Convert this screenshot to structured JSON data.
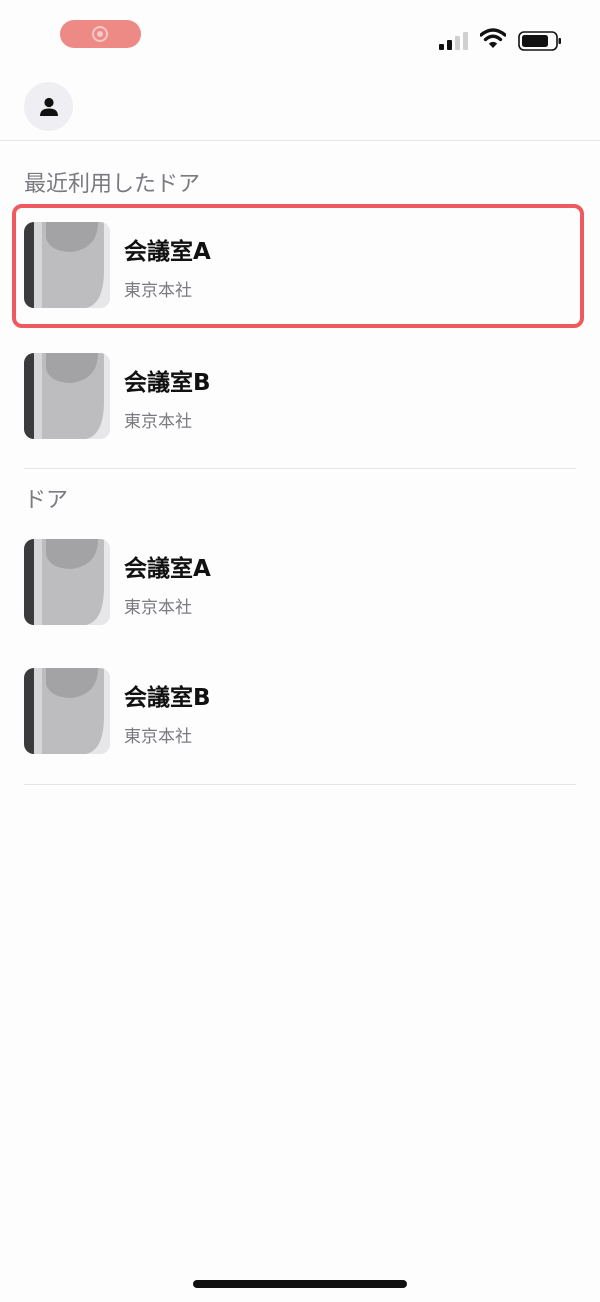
{
  "status_bar": {
    "recording_icon": "screen-recording-icon",
    "signal_icon": "cellular-signal-icon",
    "wifi_icon": "wifi-icon",
    "battery_icon": "battery-icon"
  },
  "header": {
    "profile_icon": "person-icon"
  },
  "recent_section": {
    "title": "最近利用したドア",
    "doors": [
      {
        "name": "会議室A",
        "location": "東京本社",
        "icon": "door-lock-thumbnail"
      },
      {
        "name": "会議室B",
        "location": "東京本社",
        "icon": "door-lock-thumbnail"
      }
    ]
  },
  "doors_section": {
    "title": "ドア",
    "doors": [
      {
        "name": "会議室A",
        "location": "東京本社",
        "icon": "door-lock-thumbnail"
      },
      {
        "name": "会議室B",
        "location": "東京本社",
        "icon": "door-lock-thumbnail"
      }
    ]
  },
  "colors": {
    "highlight_border": "#ef5a5e",
    "recording_pill": "#ee8a86",
    "secondary_text": "#7a7a80",
    "background": "#fdfdfd"
  }
}
